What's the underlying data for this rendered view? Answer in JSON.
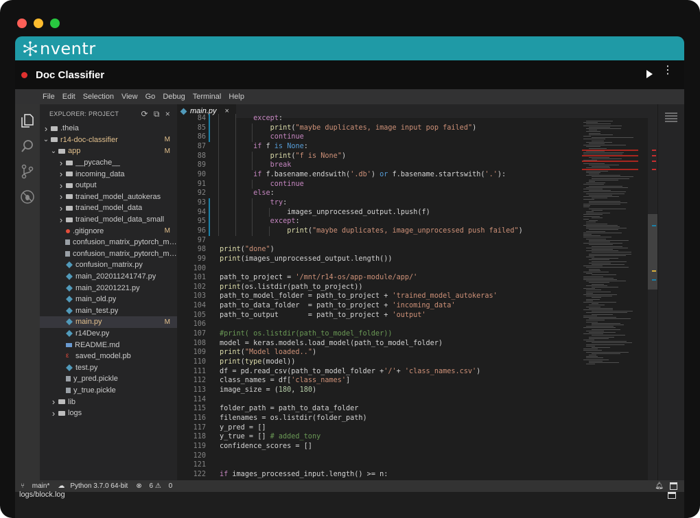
{
  "brand": {
    "name": "nventr",
    "logo": "nventr-logo"
  },
  "app": {
    "title": "Doc Classifier"
  },
  "menu": [
    "File",
    "Edit",
    "Selection",
    "View",
    "Go",
    "Debug",
    "Terminal",
    "Help"
  ],
  "explorer": {
    "title": "EXPLORER: PROJECT",
    "items": [
      {
        "label": ".theia",
        "type": "folder",
        "depth": 0,
        "expanded": false
      },
      {
        "label": "r14-doc-classifier",
        "type": "folder",
        "depth": 0,
        "expanded": true,
        "badge": "M",
        "modified": true
      },
      {
        "label": "app",
        "type": "folder",
        "depth": 1,
        "expanded": true,
        "badge": "M",
        "modified": true
      },
      {
        "label": "__pycache__",
        "type": "folder",
        "depth": 2,
        "expanded": false
      },
      {
        "label": "incoming_data",
        "type": "folder",
        "depth": 2,
        "expanded": false
      },
      {
        "label": "output",
        "type": "folder",
        "depth": 2,
        "expanded": false
      },
      {
        "label": "trained_model_autokeras",
        "type": "folder",
        "depth": 2,
        "expanded": false
      },
      {
        "label": "trained_model_data",
        "type": "folder",
        "depth": 2,
        "expanded": false
      },
      {
        "label": "trained_model_data_small",
        "type": "folder",
        "depth": 2,
        "expanded": false
      },
      {
        "label": ".gitignore",
        "type": "git",
        "depth": 2,
        "badge": "M"
      },
      {
        "label": "confusion_matrix_pytorch_mod...",
        "type": "file",
        "depth": 2
      },
      {
        "label": "confusion_matrix_pytorch_mod...",
        "type": "file",
        "depth": 2
      },
      {
        "label": "confusion_matrix.py",
        "type": "py",
        "depth": 2
      },
      {
        "label": "main_202011241747.py",
        "type": "py",
        "depth": 2
      },
      {
        "label": "main_20201221.py",
        "type": "py",
        "depth": 2
      },
      {
        "label": "main_old.py",
        "type": "py",
        "depth": 2
      },
      {
        "label": "main_test.py",
        "type": "py",
        "depth": 2
      },
      {
        "label": "main.py",
        "type": "py",
        "depth": 2,
        "badge": "M",
        "modified": true,
        "selected": true
      },
      {
        "label": "r14Dev.py",
        "type": "py",
        "depth": 2
      },
      {
        "label": "README.md",
        "type": "md",
        "depth": 2
      },
      {
        "label": "saved_model.pb",
        "type": "pb",
        "depth": 2
      },
      {
        "label": "test.py",
        "type": "py",
        "depth": 2
      },
      {
        "label": "y_pred.pickle",
        "type": "file",
        "depth": 2
      },
      {
        "label": "y_true.pickle",
        "type": "file",
        "depth": 2
      },
      {
        "label": "lib",
        "type": "folder",
        "depth": 1,
        "expanded": false
      },
      {
        "label": "logs",
        "type": "folder",
        "depth": 1,
        "expanded": false
      }
    ]
  },
  "tab": {
    "label": "main.py",
    "close": "×"
  },
  "code": [
    {
      "n": "84",
      "t": "except:",
      "i": 2,
      "bar": true
    },
    {
      "n": "85",
      "t": "print(\"maybe duplicates, image input pop failed\")",
      "i": 3,
      "bar": true
    },
    {
      "n": "86",
      "t": "continue",
      "i": 3,
      "bar": true
    },
    {
      "n": "87",
      "t": "if f is None:",
      "i": 2
    },
    {
      "n": "88",
      "t": "print(\"f is None\")",
      "i": 3
    },
    {
      "n": "89",
      "t": "break",
      "i": 3
    },
    {
      "n": "90",
      "t": "if f.basename.endswith('.db') or f.basename.startswith('.'):",
      "i": 2
    },
    {
      "n": "91",
      "t": "continue",
      "i": 3
    },
    {
      "n": "92",
      "t": "else:",
      "i": 2
    },
    {
      "n": "93",
      "t": "try:",
      "i": 3,
      "bar": true
    },
    {
      "n": "94",
      "t": "images_unprocessed_output.lpush(f)",
      "i": 4,
      "bar": true
    },
    {
      "n": "95",
      "t": "except:",
      "i": 3,
      "bar": true
    },
    {
      "n": "96",
      "t": "print(\"maybe duplicates, image_unprocessed push failed\")",
      "i": 4,
      "bar": true
    },
    {
      "n": "97",
      "t": "",
      "i": 0
    },
    {
      "n": "98",
      "t": "print(\"done\")",
      "i": 0
    },
    {
      "n": "99",
      "t": "print(images_unprocessed_output.length())",
      "i": 0
    },
    {
      "n": "100",
      "t": "",
      "i": 0
    },
    {
      "n": "101",
      "t": "path_to_project = '/mnt/r14-os/app-module/app/'",
      "i": 0
    },
    {
      "n": "102",
      "t": "print(os.listdir(path_to_project))",
      "i": 0
    },
    {
      "n": "103",
      "t": "path_to_model_folder = path_to_project + 'trained_model_autokeras'",
      "i": 0
    },
    {
      "n": "104",
      "t": "path_to_data_folder  = path_to_project + 'incoming_data'",
      "i": 0
    },
    {
      "n": "105",
      "t": "path_to_output       = path_to_project + 'output'",
      "i": 0
    },
    {
      "n": "106",
      "t": "",
      "i": 0
    },
    {
      "n": "107",
      "t": "#print( os.listdir(path_to_model_folder))",
      "i": 0
    },
    {
      "n": "108",
      "t": "model = keras.models.load_model(path_to_model_folder)",
      "i": 0
    },
    {
      "n": "109",
      "t": "print(\"Model loaded..\")",
      "i": 0
    },
    {
      "n": "110",
      "t": "print(type(model))",
      "i": 0
    },
    {
      "n": "111",
      "t": "df = pd.read_csv(path_to_model_folder +'/'+ 'class_names.csv')",
      "i": 0
    },
    {
      "n": "112",
      "t": "class_names = df['class_names']",
      "i": 0
    },
    {
      "n": "113",
      "t": "image_size = (180, 180)",
      "i": 0
    },
    {
      "n": "114",
      "t": "",
      "i": 0
    },
    {
      "n": "115",
      "t": "folder_path = path_to_data_folder",
      "i": 0
    },
    {
      "n": "116",
      "t": "filenames = os.listdir(folder_path)",
      "i": 0
    },
    {
      "n": "117",
      "t": "y_pred = []",
      "i": 0
    },
    {
      "n": "118",
      "t": "y_true = [] # added_tony",
      "i": 0
    },
    {
      "n": "119",
      "t": "confidence_scores = []",
      "i": 0
    },
    {
      "n": "120",
      "t": "",
      "i": 0
    },
    {
      "n": "121",
      "t": "",
      "i": 0
    },
    {
      "n": "122",
      "t": "if images_processed_input.length() >= n:",
      "i": 0
    }
  ],
  "status": {
    "branch": "main*",
    "python": "Python 3.7.0 64-bit",
    "errors": "6",
    "warnings": "0"
  },
  "panel": {
    "title": "logs/block.log"
  },
  "colors": {
    "brand": "#1f9aa6",
    "accent": "#1b81a8",
    "modified": "#e2c08d",
    "record": "#e0312f"
  }
}
